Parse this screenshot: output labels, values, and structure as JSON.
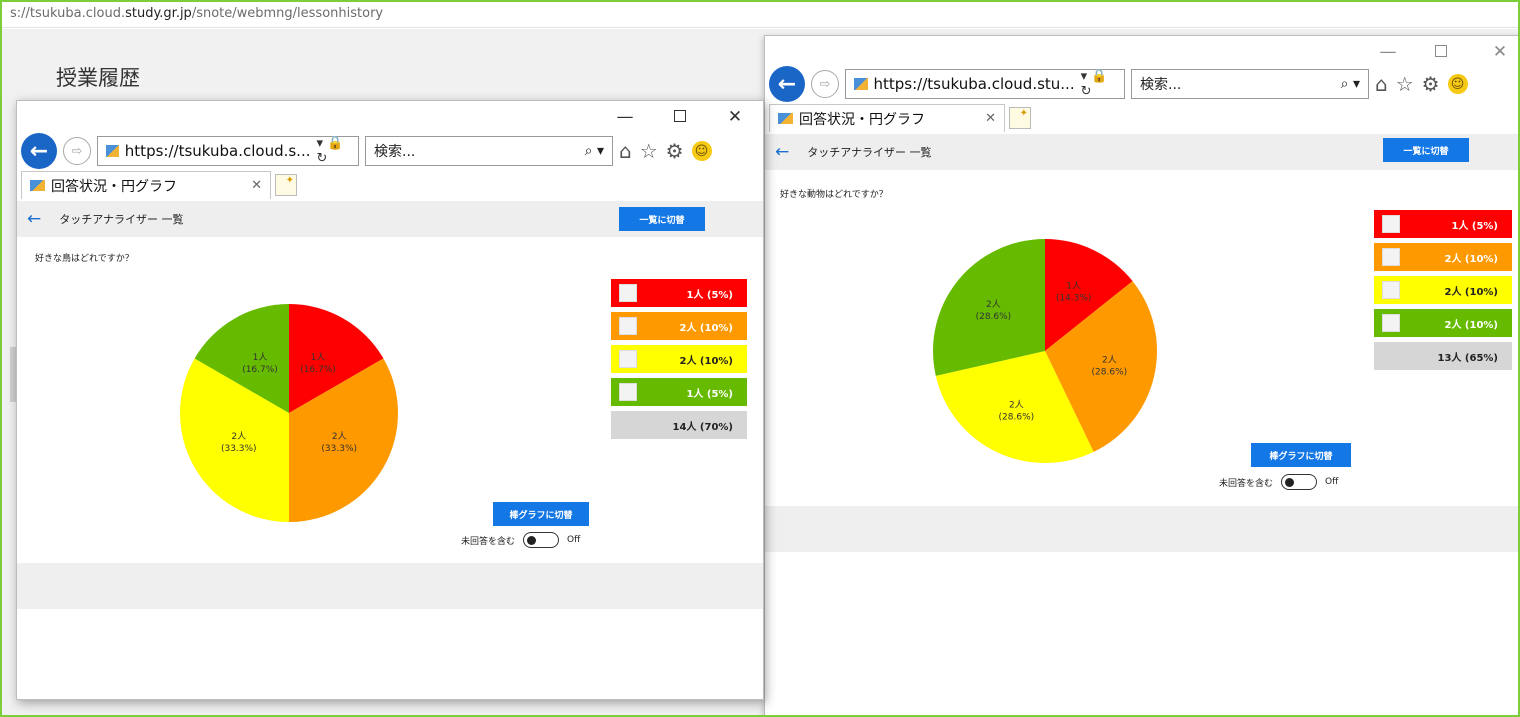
{
  "background": {
    "url_prefix": "s://tsukuba.cloud.",
    "url_domain": "study.gr.jp",
    "url_path": "/snote/webmng/lessonhistory",
    "title": "授業履歴"
  },
  "left_window": {
    "controls": {
      "minimize": "—",
      "maximize": "□",
      "close": "✕"
    },
    "address": "https://tsukuba.cloud.s...",
    "search_placeholder": "検索...",
    "tab_title": "回答状況・円グラフ",
    "header_title": "タッチアナライザー 一覧",
    "switch_list_button": "一覧に切替",
    "question": "好きな鳥はどれですか？",
    "legend": [
      {
        "label": "1人 (5%)",
        "color": "#ff0000",
        "icon": "bird-photo-icon"
      },
      {
        "label": "2人 (10%)",
        "color": "#ff9900",
        "icon": "bird-photo-icon"
      },
      {
        "label": "2人 (10%)",
        "color": "#ffff00",
        "icon": "bird-photo-icon"
      },
      {
        "label": "1人 (5%)",
        "color": "#66bb00",
        "icon": "bird-photo-icon"
      },
      {
        "label": "14人 (70%)",
        "color": "#d6d6d6",
        "icon": ""
      }
    ],
    "bar_button": "棒グラフに切替",
    "toggle_label": "未回答を含む",
    "toggle_state": "Off"
  },
  "right_window": {
    "controls": {
      "minimize": "—",
      "maximize": "□",
      "close": "✕"
    },
    "address": "https://tsukuba.cloud.stu...",
    "search_placeholder": "検索...",
    "tab_title": "回答状況・円グラフ",
    "header_title": "タッチアナライザー 一覧",
    "switch_list_button": "一覧に切替",
    "question": "好きな動物はどれですか？",
    "legend": [
      {
        "label": "1人 (5%)",
        "color": "#ff0000",
        "icon": "animal-photo-icon"
      },
      {
        "label": "2人 (10%)",
        "color": "#ff9900",
        "icon": "animal-photo-icon"
      },
      {
        "label": "2人 (10%)",
        "color": "#ffff00",
        "icon": "animal-photo-icon"
      },
      {
        "label": "2人 (10%)",
        "color": "#66bb00",
        "icon": "animal-photo-icon"
      },
      {
        "label": "13人 (65%)",
        "color": "#d6d6d6",
        "icon": ""
      }
    ],
    "bar_button": "棒グラフに切替",
    "toggle_label": "未回答を含む",
    "toggle_state": "Off"
  },
  "chart_data": [
    {
      "type": "pie",
      "title": "好きな鳥はどれですか？",
      "values": [
        1,
        2,
        2,
        1
      ],
      "colors": [
        "#ff0000",
        "#ff9900",
        "#ffff00",
        "#66bb00"
      ],
      "labels": [
        "1人",
        "2人",
        "2人",
        "1人"
      ],
      "percent_labels": [
        "(16.7%)",
        "(33.3%)",
        "(33.3%)",
        "(16.7%)"
      ]
    },
    {
      "type": "pie",
      "title": "好きな動物はどれですか？",
      "values": [
        1,
        2,
        2,
        2
      ],
      "colors": [
        "#ff0000",
        "#ff9900",
        "#ffff00",
        "#66bb00"
      ],
      "labels": [
        "1人",
        "2人",
        "2人",
        "2人"
      ],
      "percent_labels": [
        "(14.3%)",
        "(28.6%)",
        "(28.6%)",
        "(28.6%)"
      ]
    }
  ]
}
